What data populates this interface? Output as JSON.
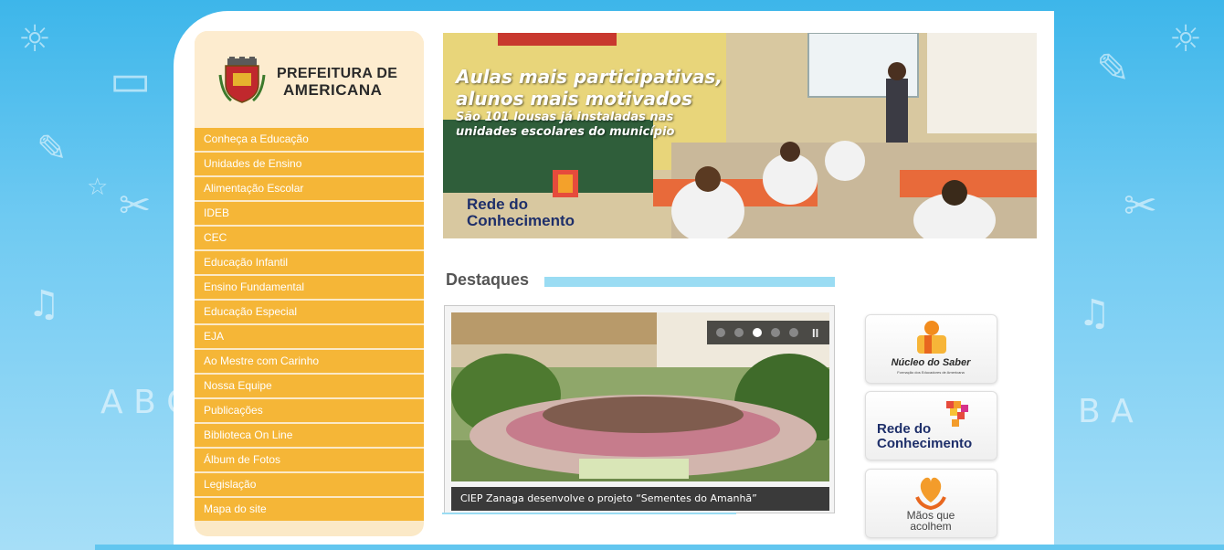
{
  "logo": {
    "line1": "PREFEITURA DE",
    "line2": "AMERICANA"
  },
  "menu": {
    "items": [
      {
        "label": "Conheça a Educação"
      },
      {
        "label": "Unidades de Ensino"
      },
      {
        "label": "Alimentação Escolar"
      },
      {
        "label": "IDEB"
      },
      {
        "label": "CEC"
      },
      {
        "label": "Educação Infantil"
      },
      {
        "label": "Ensino Fundamental"
      },
      {
        "label": "Educação Especial"
      },
      {
        "label": "EJA"
      },
      {
        "label": "Ao Mestre com Carinho"
      },
      {
        "label": "Nossa Equipe"
      },
      {
        "label": "Publicações"
      },
      {
        "label": "Biblioteca On Line"
      },
      {
        "label": "Álbum de Fotos"
      },
      {
        "label": "Legislação"
      },
      {
        "label": "Mapa do site"
      }
    ]
  },
  "banner": {
    "headline1": "Aulas mais participativas,",
    "headline2": "alunos mais motivados",
    "subline1": "São 101 lousas já instaladas nas",
    "subline2": "unidades escolares do município",
    "brand1": "Rede do",
    "brand2": "Conhecimento"
  },
  "destaques": {
    "title": "Destaques",
    "caption": "CIEP Zanaga desenvolve o projeto “Sementes do Amanhã”",
    "pause_label": "II"
  },
  "side_links": {
    "nucleo_title": "Núcleo do Saber",
    "nucleo_sub": "Formação dos Educadores de Americana",
    "rede_line1": "Rede do",
    "rede_line2": "Conhecimento",
    "maos_line1": "Mãos que",
    "maos_line2": "acolhem"
  },
  "colors": {
    "menu_bg": "#f5b637",
    "sidebar_bg": "#fbe9c7",
    "accent_blue": "#9adcf3",
    "page_bg": "#3db6ea"
  }
}
